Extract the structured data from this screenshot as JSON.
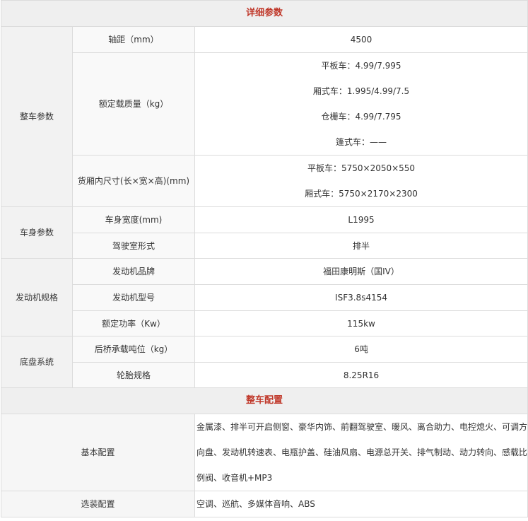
{
  "detail_section": {
    "title": "详细参数",
    "groups": [
      {
        "label": "整车参数",
        "rows": [
          {
            "param": "轴距（mm）",
            "values": [
              "4500"
            ]
          },
          {
            "param": "额定载质量（kg）",
            "values": [
              "平板车：4.99/7.995",
              "厢式车：1.995/4.99/7.5",
              "仓栅车：4.99/7.795",
              "篷式车：——"
            ]
          },
          {
            "param": "货厢内尺寸(长×宽×高)(mm)",
            "values": [
              "平板车：5750×2050×550",
              "厢式车：5750×2170×2300"
            ]
          }
        ]
      },
      {
        "label": "车身参数",
        "rows": [
          {
            "param": "车身宽度(mm)",
            "values": [
              "L1995"
            ]
          },
          {
            "param": "驾驶室形式",
            "values": [
              "排半"
            ]
          }
        ]
      },
      {
        "label": "发动机规格",
        "rows": [
          {
            "param": "发动机品牌",
            "values": [
              "福田康明斯（国IV）"
            ]
          },
          {
            "param": "发动机型号",
            "values": [
              "ISF3.8s4154"
            ]
          },
          {
            "param": "额定功率（Kw）",
            "values": [
              "115kw"
            ]
          }
        ]
      },
      {
        "label": "底盘系统",
        "rows": [
          {
            "param": "后桥承载吨位（kg）",
            "values": [
              "6吨"
            ]
          },
          {
            "param": "轮胎规格",
            "values": [
              "8.25R16"
            ]
          }
        ]
      }
    ]
  },
  "config_section": {
    "title": "整车配置",
    "rows": [
      {
        "label": "基本配置",
        "value": "金属漆、排半可开启侧窗、豪华内饰、前翻驾驶室、暖风、离合助力、电控熄火、可调方向盘、发动机转速表、电瓶护盖、硅油风扇、电源总开关、排气制动、动力转向、感载比例阀、收音机+MP3"
      },
      {
        "label": "选装配置",
        "value": "空调、巡航、多媒体音响、ABS"
      }
    ]
  }
}
